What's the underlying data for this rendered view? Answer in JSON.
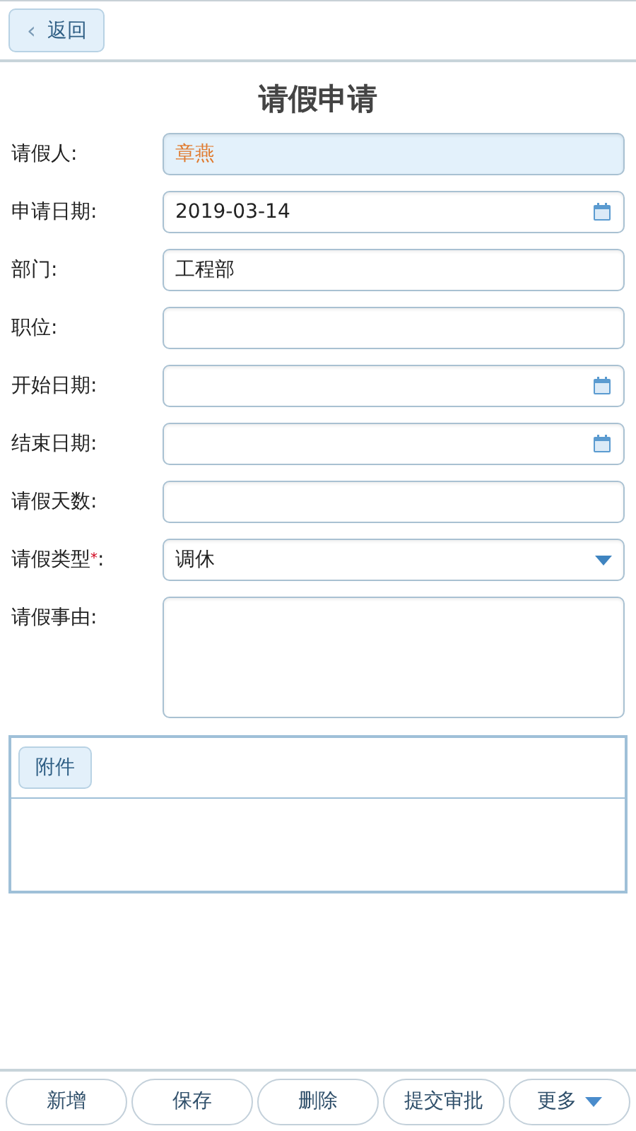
{
  "back_button": {
    "label": "返回",
    "icon": "‹"
  },
  "title": "请假申请",
  "fields": [
    {
      "label": "请假人",
      "colon": ":",
      "kind": "text",
      "value": "章燕",
      "readonly": true
    },
    {
      "label": "申请日期",
      "colon": ":",
      "kind": "date",
      "value": "2019-03-14",
      "readonly": false
    },
    {
      "label": "部门",
      "colon": ":",
      "kind": "text",
      "value": "工程部",
      "readonly": false
    },
    {
      "label": "职位",
      "colon": ":",
      "kind": "text",
      "readonly": false
    },
    {
      "label": "开始日期",
      "colon": ":",
      "kind": "date",
      "readonly": false
    },
    {
      "label": "结束日期",
      "colon": ":",
      "kind": "date",
      "readonly": false
    },
    {
      "label": "请假天数",
      "colon": ":",
      "kind": "text",
      "readonly": false
    },
    {
      "label": "请假类型",
      "required_mark": "*",
      "colon": ":",
      "kind": "select",
      "value": "调休",
      "readonly": false
    },
    {
      "label": "请假事由",
      "colon": ":",
      "kind": "textarea",
      "readonly": false
    }
  ],
  "attachments": {
    "button": "附件"
  },
  "toolbar": [
    {
      "label": "新增",
      "kind": "plain"
    },
    {
      "label": "保存",
      "kind": "plain"
    },
    {
      "label": "删除",
      "kind": "plain"
    },
    {
      "label": "提交审批",
      "kind": "plain"
    },
    {
      "label": "更多",
      "kind": "menu"
    }
  ]
}
